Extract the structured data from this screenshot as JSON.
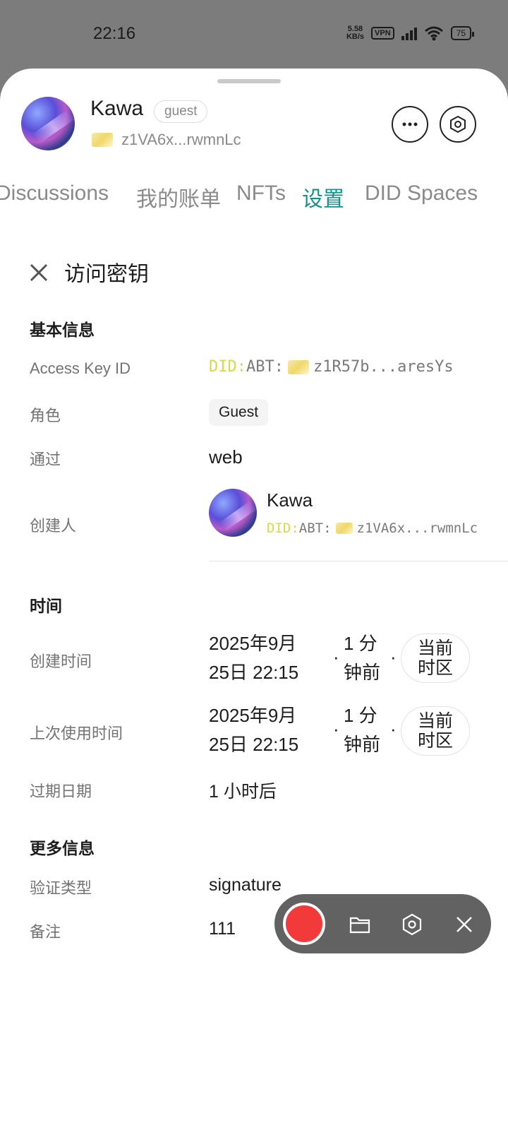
{
  "status_bar": {
    "time": "22:16",
    "speed_value": "5.58",
    "speed_unit": "KB/s",
    "vpn": "VPN",
    "hd": "HD",
    "battery": "75"
  },
  "profile": {
    "name": "Kawa",
    "role": "guest",
    "did_short": "z1VA6x...rwmnLc"
  },
  "tabs": [
    "Discussions",
    "我的账单",
    "NFTs",
    "设置",
    "DID Spaces"
  ],
  "active_tab": "设置",
  "page": {
    "title": "访问密钥"
  },
  "basic_info": {
    "heading": "基本信息",
    "access_key_label": "Access Key ID",
    "access_key_prefix": "DID:",
    "access_key_abt": "ABT:",
    "access_key_value": "z1R57b...aresYs",
    "role_label": "角色",
    "role_value": "Guest",
    "via_label": "通过",
    "via_value": "web",
    "creator_label": "创建人",
    "creator_name": "Kawa",
    "creator_did_prefix": "DID:",
    "creator_did_abt": "ABT:",
    "creator_did_value": "z1VA6x...rwmnLc"
  },
  "time_info": {
    "heading": "时间",
    "created_label": "创建时间",
    "created_line1": "2025年9月",
    "created_line2": "25日 22:15",
    "created_rel1": "1 分",
    "created_rel2": "钟前",
    "created_tz1": "当前",
    "created_tz2": "时区",
    "last_used_label": "上次使用时间",
    "last_used_line1": "2025年9月",
    "last_used_line2": "25日 22:15",
    "last_used_rel1": "1 分",
    "last_used_rel2": "钟前",
    "last_used_tz1": "当前",
    "last_used_tz2": "时区",
    "expire_label": "过期日期",
    "expire_value": "1 小时后"
  },
  "more_info": {
    "heading": "更多信息",
    "auth_type_label": "验证类型",
    "auth_type_value": "signature",
    "remark_label": "备注",
    "remark_value": "111"
  },
  "recorder": {
    "record_color": "#f23a3a",
    "icons": [
      "record-icon",
      "folder-icon",
      "settings-icon",
      "close-icon"
    ]
  },
  "accent_color": "#14918a"
}
